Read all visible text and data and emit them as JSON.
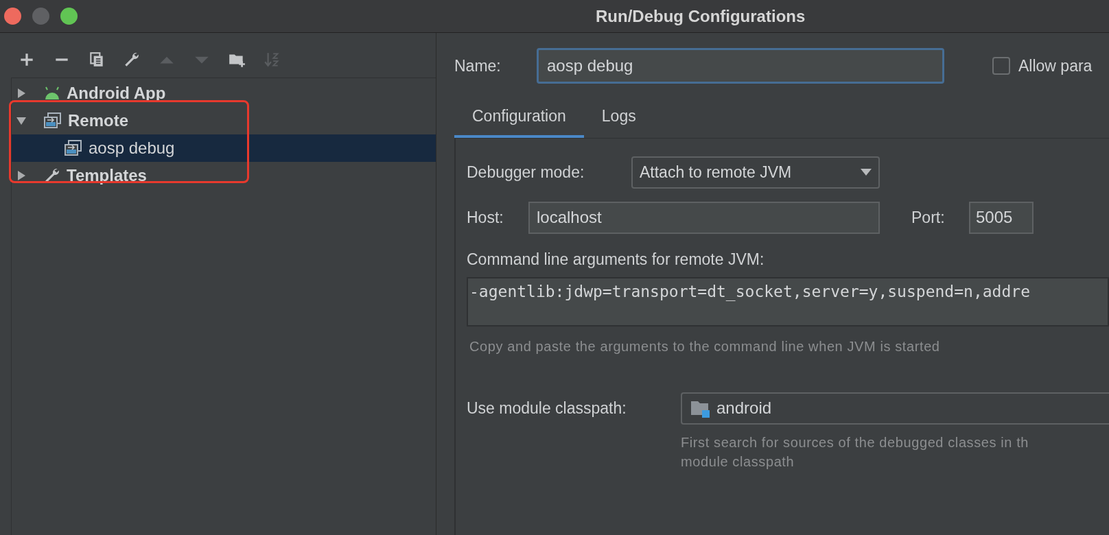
{
  "window": {
    "title": "Run/Debug Configurations"
  },
  "toolbar": [
    {
      "kind": "add",
      "disabled": false
    },
    {
      "kind": "remove",
      "disabled": false
    },
    {
      "kind": "copy",
      "disabled": false
    },
    {
      "kind": "wrench",
      "disabled": false
    },
    {
      "kind": "up",
      "disabled": true
    },
    {
      "kind": "down",
      "disabled": true
    },
    {
      "kind": "folder",
      "disabled": false
    },
    {
      "kind": "sort",
      "disabled": true
    }
  ],
  "tree": {
    "items": [
      {
        "label": "Android App",
        "kind": "android",
        "expanded": false,
        "selected": false
      },
      {
        "label": "Remote",
        "kind": "remote",
        "expanded": true,
        "selected": false,
        "children": [
          {
            "label": "aosp debug",
            "kind": "remote",
            "selected": true
          }
        ]
      },
      {
        "label": "Templates",
        "kind": "wrench",
        "expanded": false,
        "selected": false
      }
    ]
  },
  "name_field": {
    "label": "Name:",
    "value": "aosp debug"
  },
  "allow_parallel": {
    "label": "Allow para",
    "checked": false
  },
  "tabs": [
    {
      "label": "Configuration",
      "selected": true
    },
    {
      "label": "Logs",
      "selected": false
    }
  ],
  "config": {
    "debugger_mode": {
      "label": "Debugger mode:",
      "value": "Attach to remote JVM"
    },
    "host": {
      "label": "Host:",
      "value": "localhost"
    },
    "port": {
      "label": "Port:",
      "value": "5005"
    },
    "command_line": {
      "label": "Command line arguments for remote JVM:",
      "value": "-agentlib:jdwp=transport=dt_socket,server=y,suspend=n,addre"
    },
    "command_hint": "Copy and paste the arguments to the command line when JVM is started",
    "module_classpath": {
      "label": "Use module classpath:",
      "value": "android"
    },
    "module_hint": [
      "First search for sources of the debugged classes in th",
      "module classpath"
    ]
  }
}
